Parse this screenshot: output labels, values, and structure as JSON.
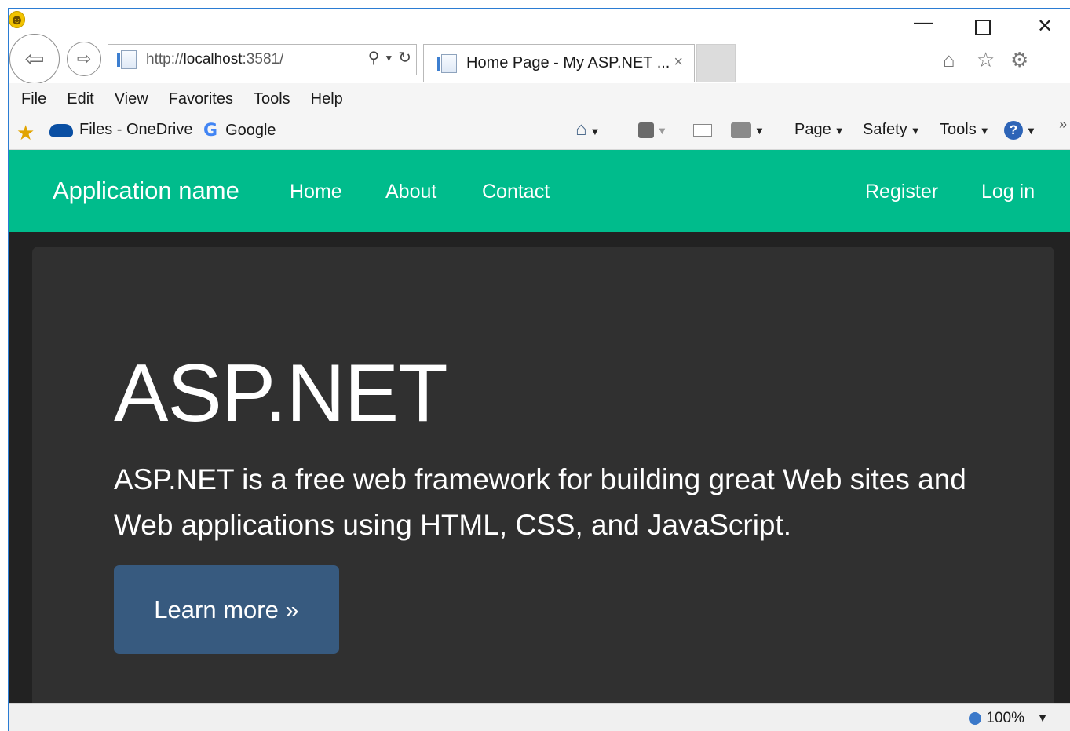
{
  "browser": {
    "url_prefix": "http://",
    "url_host": "localhost",
    "url_rest": ":3581/",
    "tab_title": "Home Page - My ASP.NET ...",
    "tab_close": "×",
    "window_controls": {
      "minimize": "—",
      "close": "✕"
    },
    "menu": [
      "File",
      "Edit",
      "View",
      "Favorites",
      "Tools",
      "Help"
    ],
    "favorites": [
      {
        "label": "Files - OneDrive",
        "icon": "onedrive-icon"
      },
      {
        "label": "Google",
        "icon": "google-icon",
        "glyph": "G"
      }
    ],
    "commands": {
      "page": "Page",
      "safety": "Safety",
      "tools": "Tools",
      "help_glyph": "?"
    },
    "status": {
      "zoom": "100%"
    }
  },
  "site": {
    "brand": "Application name",
    "nav_left": [
      "Home",
      "About",
      "Contact"
    ],
    "nav_right": [
      "Register",
      "Log in"
    ],
    "hero_title": "ASP.NET",
    "hero_lead": "ASP.NET is a free web framework for building great Web sites and Web applications using HTML, CSS, and JavaScript.",
    "cta": "Learn more »"
  },
  "colors": {
    "navbar": "#00bc8c",
    "page_background": "#222222",
    "jumbotron": "#303030",
    "button": "#375a7f",
    "text": "#ffffff"
  }
}
